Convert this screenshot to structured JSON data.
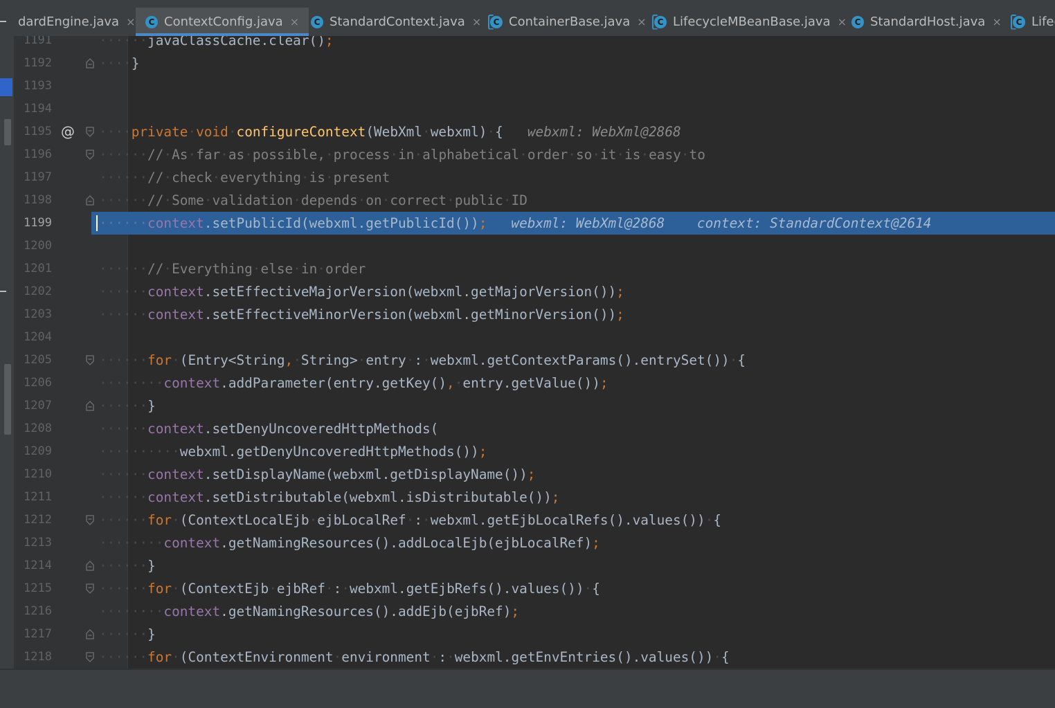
{
  "tabs": [
    {
      "label": "dardEngine.java",
      "icon": "class-icon",
      "active": false,
      "closable": true
    },
    {
      "label": "ContextConfig.java",
      "icon": "class-icon",
      "active": true,
      "closable": true
    },
    {
      "label": "StandardContext.java",
      "icon": "class-icon",
      "active": false,
      "closable": true
    },
    {
      "label": "ContainerBase.java",
      "icon": "abstract-class-icon",
      "active": false,
      "closable": true
    },
    {
      "label": "LifecycleMBeanBase.java",
      "icon": "abstract-class-icon",
      "active": false,
      "closable": true
    },
    {
      "label": "StandardHost.java",
      "icon": "class-icon",
      "active": false,
      "closable": true
    },
    {
      "label": "Lifec",
      "icon": "abstract-class-icon",
      "active": false,
      "closable": false
    }
  ],
  "icon_letter": "C",
  "close_glyph": "×",
  "editor": {
    "current_line": "1199",
    "lines": [
      {
        "num": "1191",
        "code": "javaClassCache.clear();"
      },
      {
        "num": "1192",
        "code": "}"
      },
      {
        "num": "1193",
        "code": ""
      },
      {
        "num": "1194",
        "code": ""
      },
      {
        "num": "1195",
        "code": "private void configureContext(WebXml webxml) {",
        "hint": "webxml: WebXml@2868"
      },
      {
        "num": "1196",
        "code": "// As far as possible, process in alphabetical order so it is easy to"
      },
      {
        "num": "1197",
        "code": "// check everything is present"
      },
      {
        "num": "1198",
        "code": "// Some validation depends on correct public ID"
      },
      {
        "num": "1199",
        "code": "context.setPublicId(webxml.getPublicId());",
        "hint": "webxml: WebXml@2868    context: StandardContext@2614"
      },
      {
        "num": "1200",
        "code": ""
      },
      {
        "num": "1201",
        "code": "// Everything else in order"
      },
      {
        "num": "1202",
        "code": "context.setEffectiveMajorVersion(webxml.getMajorVersion());"
      },
      {
        "num": "1203",
        "code": "context.setEffectiveMinorVersion(webxml.getMinorVersion());"
      },
      {
        "num": "1204",
        "code": ""
      },
      {
        "num": "1205",
        "code": "for (Entry<String, String> entry : webxml.getContextParams().entrySet()) {"
      },
      {
        "num": "1206",
        "code": "context.addParameter(entry.getKey(), entry.getValue());"
      },
      {
        "num": "1207",
        "code": "}"
      },
      {
        "num": "1208",
        "code": "context.setDenyUncoveredHttpMethods("
      },
      {
        "num": "1209",
        "code": "webxml.getDenyUncoveredHttpMethods());"
      },
      {
        "num": "1210",
        "code": "context.setDisplayName(webxml.getDisplayName());"
      },
      {
        "num": "1211",
        "code": "context.setDistributable(webxml.isDistributable());"
      },
      {
        "num": "1212",
        "code": "for (ContextLocalEjb ejbLocalRef : webxml.getEjbLocalRefs().values()) {"
      },
      {
        "num": "1213",
        "code": "context.getNamingResources().addLocalEjb(ejbLocalRef);"
      },
      {
        "num": "1214",
        "code": "}"
      },
      {
        "num": "1215",
        "code": "for (ContextEjb ejbRef : webxml.getEjbRefs().values()) {"
      },
      {
        "num": "1216",
        "code": "context.getNamingResources().addEjb(ejbRef);"
      },
      {
        "num": "1217",
        "code": "}"
      },
      {
        "num": "1218",
        "code": "for (ContextEnvironment environment : webxml.getEnvEntries().values()) {"
      }
    ]
  },
  "colors": {
    "keyword": "#cc7832",
    "method_decl": "#ffc66d",
    "field": "#9876aa",
    "comment": "#808080",
    "text": "#a9b7c6",
    "highlight": "#2d6099",
    "tab_accent": "#4a88c7"
  }
}
